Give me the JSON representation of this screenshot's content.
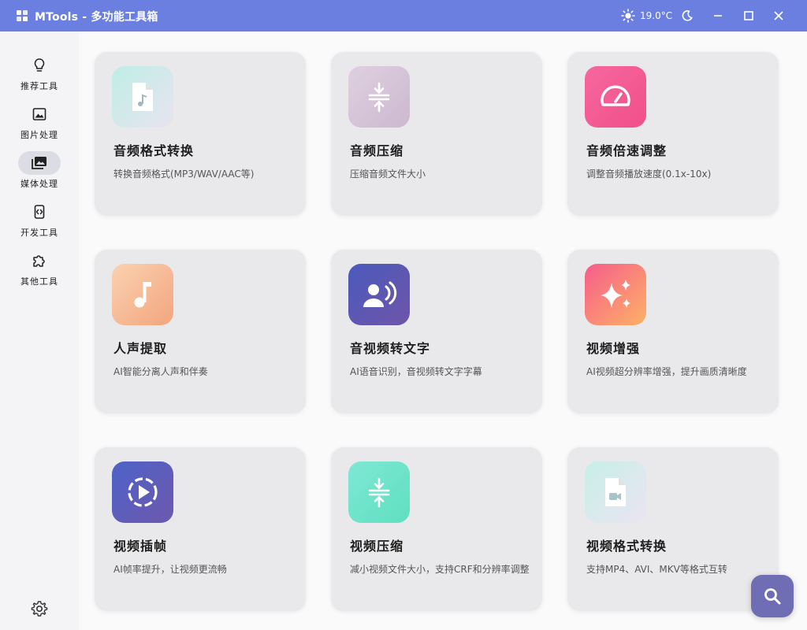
{
  "window": {
    "title": "MTools - 多功能工具箱",
    "weather_temp": "19.0°C",
    "accent": "#6b7fe0"
  },
  "sidebar": {
    "items": [
      {
        "label": "推荐工具",
        "icon": "lightbulb-icon"
      },
      {
        "label": "图片处理",
        "icon": "image-icon"
      },
      {
        "label": "媒体处理",
        "icon": "media-library-icon",
        "active": true
      },
      {
        "label": "开发工具",
        "icon": "dev-tools-icon"
      },
      {
        "label": "其他工具",
        "icon": "puzzle-icon"
      }
    ],
    "settings_icon": "gear-icon"
  },
  "tools": [
    {
      "title": "音频格式转换",
      "desc": "转换音频格式(MP3/WAV/AAC等)",
      "icon": "audio-file-icon"
    },
    {
      "title": "音频压缩",
      "desc": "压缩音频文件大小",
      "icon": "compress-icon"
    },
    {
      "title": "音频倍速调整",
      "desc": "调整音频播放速度(0.1x-10x)",
      "icon": "speedometer-icon"
    },
    {
      "title": "人声提取",
      "desc": "AI智能分离人声和伴奏",
      "icon": "music-note-icon"
    },
    {
      "title": "音视频转文字",
      "desc": "AI语音识别，音视频转文字字幕",
      "icon": "voice-recognition-icon"
    },
    {
      "title": "视频增强",
      "desc": "AI视频超分辨率增强，提升画质清晰度",
      "icon": "sparkle-icon"
    },
    {
      "title": "视频插帧",
      "desc": "AI帧率提升，让视频更流畅",
      "icon": "play-circle-icon"
    },
    {
      "title": "视频压缩",
      "desc": "减小视频文件大小，支持CRF和分辨率调整",
      "icon": "compress-icon"
    },
    {
      "title": "视频格式转换",
      "desc": "支持MP4、AVI、MKV等格式互转",
      "icon": "video-file-icon"
    }
  ],
  "fab_icon": "search-icon"
}
